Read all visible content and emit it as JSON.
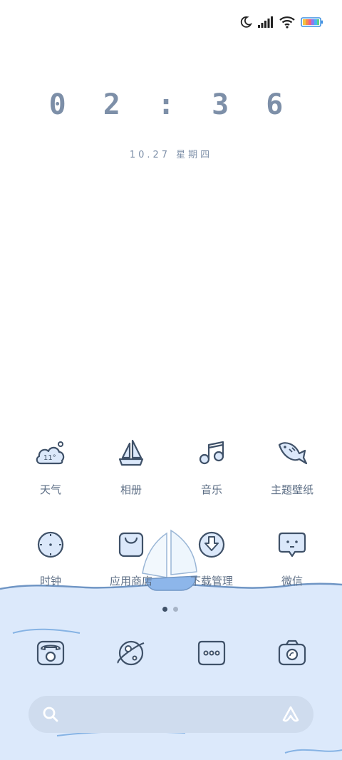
{
  "status_bar": {
    "icons": [
      "moon-icon",
      "signal-icon",
      "wifi-icon",
      "battery-icon"
    ],
    "battery_colors": [
      "#f4c542",
      "#f58a4b",
      "#ef5f8a",
      "#8b7bf0",
      "#4cb4f2",
      "#5bd28a"
    ]
  },
  "clock": {
    "time": "0 2 : 3 6",
    "date": "10.27  星期四"
  },
  "apps_row1": [
    {
      "label": "天气",
      "icon": "weather-icon",
      "badge": "11°"
    },
    {
      "label": "相册",
      "icon": "sailboat-gallery-icon"
    },
    {
      "label": "音乐",
      "icon": "music-note-icon"
    },
    {
      "label": "主题壁纸",
      "icon": "fish-theme-icon"
    }
  ],
  "apps_row2": [
    {
      "label": "时钟",
      "icon": "clock-icon"
    },
    {
      "label": "应用商店",
      "icon": "shopping-bag-icon"
    },
    {
      "label": "下载管理",
      "icon": "download-icon"
    },
    {
      "label": "微信",
      "icon": "chat-bubble-icon"
    }
  ],
  "page_indicator": {
    "pages": 2,
    "current": 1
  },
  "dock": [
    {
      "icon": "phone-icon"
    },
    {
      "icon": "planet-browser-icon"
    },
    {
      "icon": "messages-icon"
    },
    {
      "icon": "camera-icon"
    }
  ],
  "search_bar": {
    "left_icon": "search-icon",
    "right_icon": "assistant-icon"
  },
  "colors": {
    "icon_stroke": "#3f5168",
    "icon_fill": "#dbe8fa",
    "sea": "#dce9fb",
    "wave": "#86b3e4"
  }
}
